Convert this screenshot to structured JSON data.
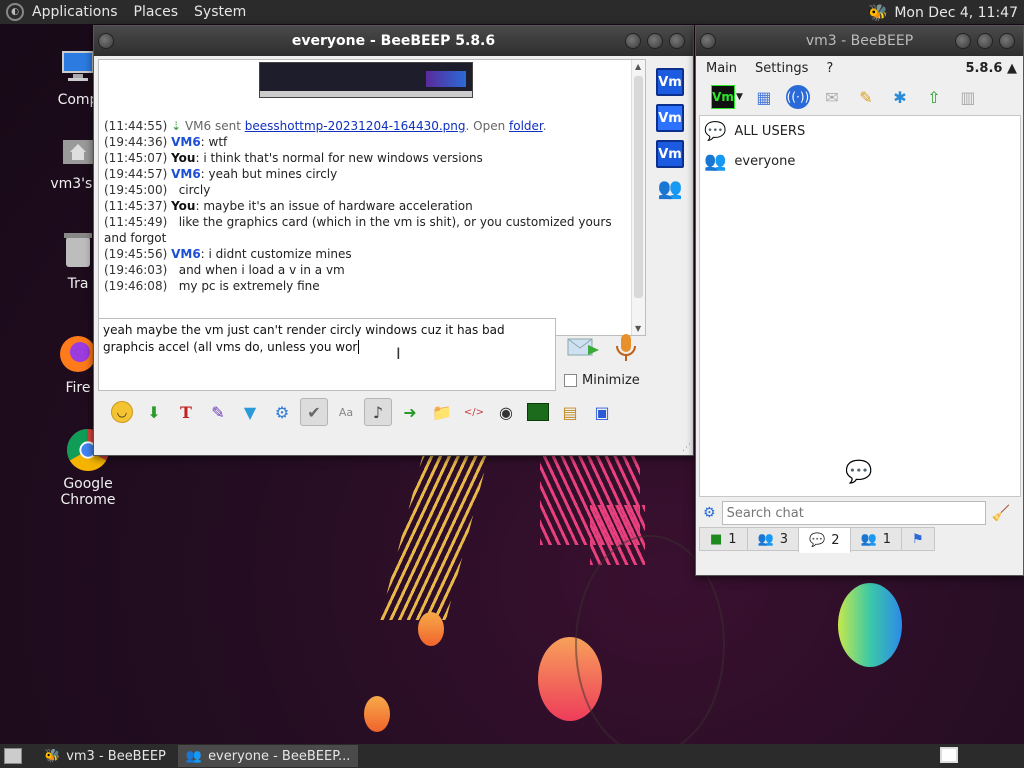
{
  "top_panel": {
    "menus": [
      "Applications",
      "Places",
      "System"
    ],
    "clock": "Mon Dec  4, 11:47"
  },
  "desktop_icons": [
    {
      "label": "Comp"
    },
    {
      "label": "vm3's h"
    },
    {
      "label": "Tra"
    },
    {
      "label": "Fire"
    },
    {
      "label": "Google Chrome"
    }
  ],
  "chat_window": {
    "title": "everyone - BeeBEEP 5.8.6",
    "lines": [
      {
        "ts": "(11:44:55)",
        "text": " VM6 sent ",
        "link": "beesshottmp-20231204-164430.png",
        "tail": ". Open ",
        "link2": "folder",
        "end": "."
      },
      {
        "ts": "(19:44:36)",
        "nick": "VM6",
        "nick_type": "vm",
        "text": ": wtf"
      },
      {
        "ts": "(11:45:07)",
        "nick": "You",
        "nick_type": "you",
        "text": ": i think that's normal for new windows versions"
      },
      {
        "ts": "(19:44:57)",
        "nick": "VM6",
        "nick_type": "vm",
        "text": ": yeah but mines circly"
      },
      {
        "ts": "(19:45:00)",
        "text": "   circly"
      },
      {
        "ts": "(11:45:37)",
        "nick": "You",
        "nick_type": "you",
        "text": ": maybe it's an issue of hardware acceleration"
      },
      {
        "ts": "(11:45:49)",
        "text": "   like the graphics card (which in the vm is shit), or you customized yours and forgot"
      },
      {
        "ts": "(19:45:56)",
        "nick": "VM6",
        "nick_type": "vm",
        "text": ": i didnt customize mines"
      },
      {
        "ts": "(19:46:03)",
        "text": "   and when i load a v in a vm"
      },
      {
        "ts": "(19:46:08)",
        "text": "   my pc is extremely fine"
      }
    ],
    "input_text": "yeah maybe the vm just can't render circly windows cuz it has bad graphcis accel (all vms do, unless you wor",
    "minimize_label": "Minimize",
    "side_badges": [
      "Vm",
      "Vm",
      "Vm"
    ]
  },
  "main_window": {
    "title": "vm3 - BeeBEEP",
    "menus": [
      "Main",
      "Settings",
      "?"
    ],
    "version": "5.8.6",
    "toolbar_badge": "Vm",
    "users": [
      "ALL USERS",
      "everyone"
    ],
    "search_placeholder": "Search chat",
    "tabs": [
      {
        "count": "1",
        "icon": "user-status-icon"
      },
      {
        "count": "3",
        "icon": "group-icon"
      },
      {
        "count": "2",
        "icon": "chat-icon",
        "active": true
      },
      {
        "count": "1",
        "icon": "users-icon"
      },
      {
        "count": "",
        "icon": "pin-icon"
      }
    ]
  },
  "taskbar": {
    "tasks": [
      "vm3 - BeeBEEP",
      "everyone - BeeBEEP..."
    ]
  },
  "colors": {
    "panel": "#2b2b2b",
    "vm_badge": "#1a5be0",
    "link": "#1030c0"
  }
}
